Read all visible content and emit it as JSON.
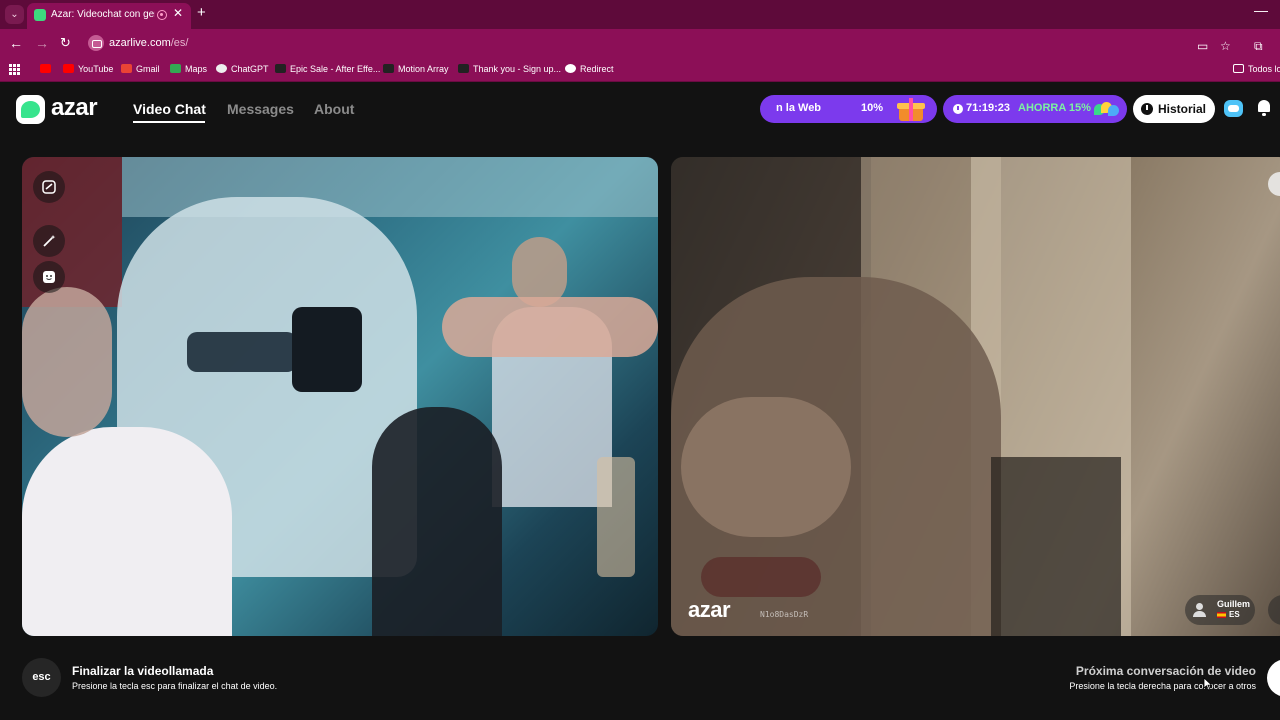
{
  "browser": {
    "tab_title": "Azar: Videochat con gente nueva",
    "url_host": "azarlive.com",
    "url_path": "/es/",
    "bookmarks": [
      "YouTube",
      "Gmail",
      "Maps",
      "ChatGPT",
      "Epic Sale - After Effe...",
      "Motion Array",
      "Thank you - Sign up...",
      "Redirect"
    ],
    "all_bookmarks": "Todos los"
  },
  "header": {
    "logo": "azar",
    "nav": [
      "Video Chat",
      "Messages",
      "About"
    ],
    "promo_web_text": "n la Web",
    "promo_web_pct": "10%",
    "timer": "71:19:23",
    "ahorra": "AHORRA 15%",
    "historial": "Historial"
  },
  "video": {
    "watermark": "azar",
    "watermark_id": "N1o8DasDzR",
    "partner_name": "Guillem",
    "partner_country": "ES"
  },
  "footer": {
    "esc_key": "esc",
    "end_title": "Finalizar la videollamada",
    "end_desc": "Presione la tecla esc para finalizar el chat de video.",
    "next_title": "Próxima conversación de video",
    "next_desc": "Presione la tecla derecha para conocer a otros"
  }
}
